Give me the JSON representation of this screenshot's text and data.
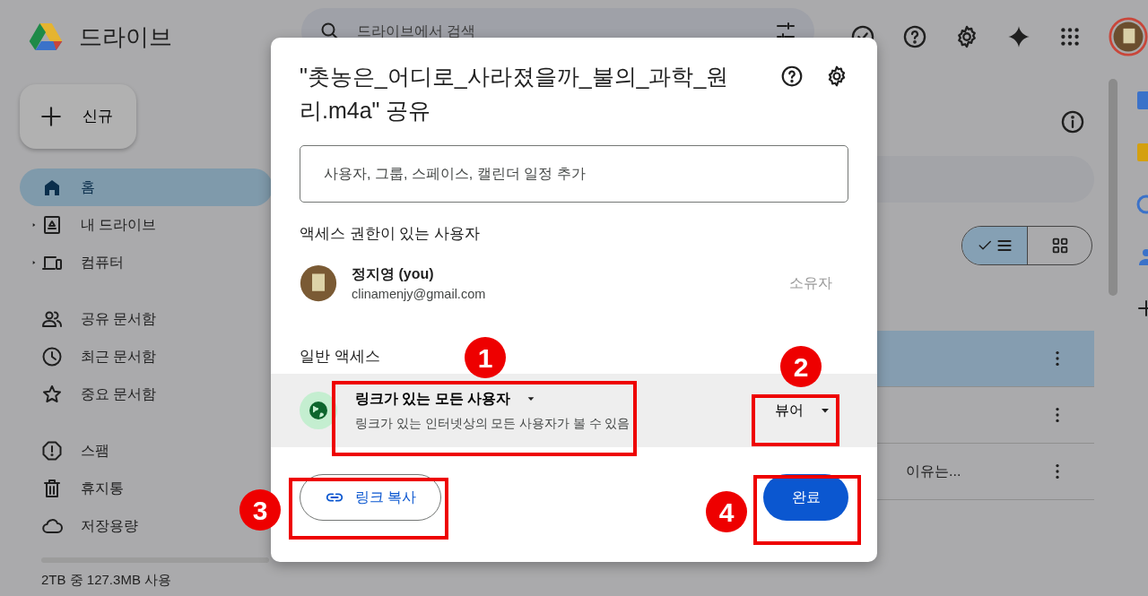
{
  "app": {
    "name": "드라이브"
  },
  "search": {
    "placeholder": "드라이브에서 검색"
  },
  "new_button": {
    "label": "신규"
  },
  "sidebar": {
    "items": [
      {
        "kind": "home",
        "label": "홈",
        "selected": true,
        "expandable": false
      },
      {
        "kind": "drive",
        "label": "내 드라이브",
        "selected": false,
        "expandable": true
      },
      {
        "kind": "computer",
        "label": "컴퓨터",
        "selected": false,
        "expandable": true
      },
      {
        "kind": "shared",
        "label": "공유 문서함",
        "selected": false,
        "expandable": false
      },
      {
        "kind": "recent",
        "label": "최근 문서함",
        "selected": false,
        "expandable": false
      },
      {
        "kind": "starred",
        "label": "중요 문서함",
        "selected": false,
        "expandable": false
      },
      {
        "kind": "spam",
        "label": "스팸",
        "selected": false,
        "expandable": false
      },
      {
        "kind": "trash",
        "label": "휴지통",
        "selected": false,
        "expandable": false
      },
      {
        "kind": "storage",
        "label": "저장용량",
        "selected": false,
        "expandable": false
      }
    ]
  },
  "storage": {
    "level": 0.0,
    "text": "2TB 중 127.3MB 사용"
  },
  "view_toggle": [
    {
      "kind": "list",
      "selected": true
    },
    {
      "kind": "grid",
      "selected": false
    }
  ],
  "rows": [
    {
      "selected": true
    },
    {
      "selected": false
    },
    {
      "selected": false,
      "text": "이유는..."
    }
  ],
  "dialog": {
    "title": "\"촛농은_어디로_사라졌을까_불의_과학_원리.m4a\" 공유",
    "input": {
      "placeholder": "사용자, 그룹, 스페이스, 캘린더 일정 추가"
    },
    "people_heading": "액세스 권한이 있는 사용자",
    "people": [
      {
        "name": "정지영 (you)",
        "email": "clinamenjy@gmail.com",
        "role": "소유자"
      }
    ],
    "general_heading": "일반 액세스",
    "general_access": {
      "scope": "링크가 있는 모든 사용자",
      "description": "링크가 있는 인터넷상의 모든 사용자가 볼 수 있음",
      "role": "뷰어"
    },
    "copy_link": "링크 복사",
    "done": "완료"
  },
  "annotations": [
    {
      "label": "1"
    },
    {
      "label": "2"
    },
    {
      "label": "3"
    },
    {
      "label": "4"
    }
  ]
}
